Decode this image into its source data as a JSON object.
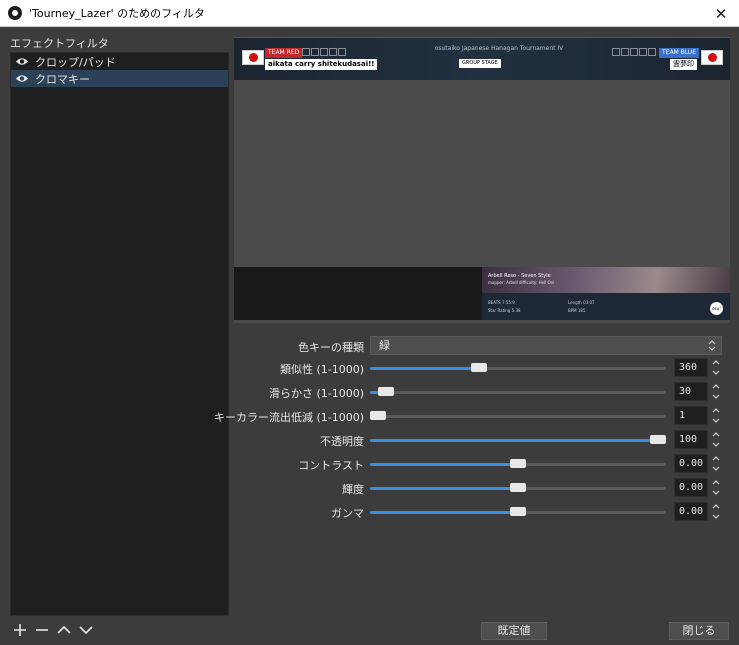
{
  "window": {
    "title": "'Tourney_Lazer' のためのフィルタ",
    "close_glyph": "✕"
  },
  "filters": {
    "label": "エフェクトフィルタ",
    "items": [
      {
        "label": "クロップ/パッド",
        "selected": false
      },
      {
        "label": "クロマキー",
        "selected": true
      }
    ]
  },
  "preview": {
    "team_red": "TEAM RED",
    "team_blue": "TEAM BLUE",
    "red_player": "aikata carry shitekudasai!!",
    "blue_player": "霊夢印",
    "tournament": "osutaiko Japanese Hanagan Tournament IV",
    "stage": "GROUP STAGE",
    "song_title": "Arbell Reso - Seven Style",
    "song_mapper": "mapper: Arbell   difficulty: Hell Oni",
    "stat_1": "BEATS 7:55:9",
    "stat_2": "Star Rating 5.38",
    "stat_3": "Length 03:07",
    "stat_4": "BPM 185",
    "osu_logo": "osu!"
  },
  "settings": {
    "key_type": {
      "label": "色キーの種類",
      "value": "緑"
    },
    "similarity": {
      "label": "類似性 (1-1000)",
      "value": "360",
      "fraction": 0.36
    },
    "smoothness": {
      "label": "滑らかさ (1-1000)",
      "value": "30",
      "fraction": 0.03
    },
    "spill": {
      "label": "キーカラー流出低減 (1-1000)",
      "value": "1",
      "fraction": 0.0
    },
    "opacity": {
      "label": "不透明度",
      "value": "100",
      "fraction": 1.0
    },
    "contrast": {
      "label": "コントラスト",
      "value": "0.00",
      "fraction": 0.5
    },
    "brightness": {
      "label": "輝度",
      "value": "0.00",
      "fraction": 0.5
    },
    "gamma": {
      "label": "ガンマ",
      "value": "0.00",
      "fraction": 0.5
    }
  },
  "buttons": {
    "defaults": "既定値",
    "close": "閉じる"
  },
  "colors": {
    "accent": "#3b8fe0",
    "selected_row": "#2b4157",
    "background": "#3c3c3c"
  }
}
